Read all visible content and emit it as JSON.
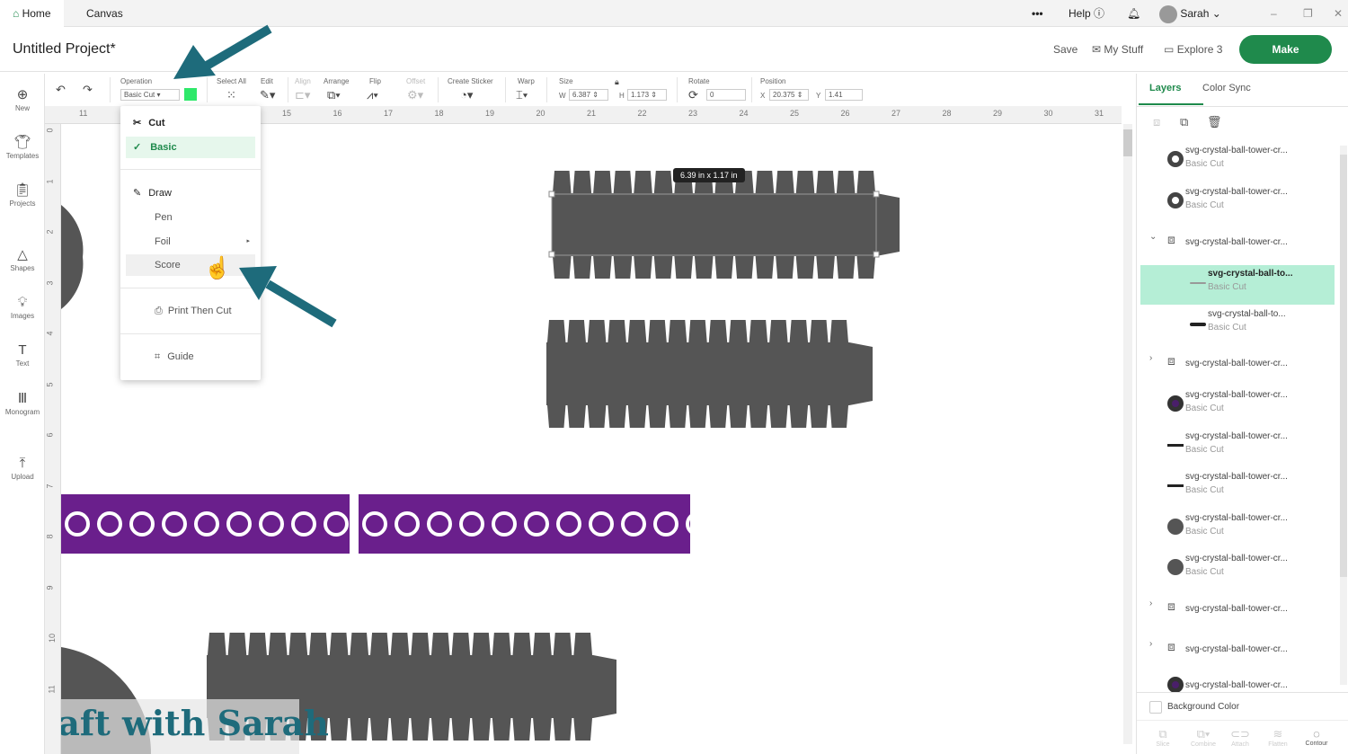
{
  "topbar": {
    "tabs": [
      {
        "label": "Home"
      },
      {
        "label": "Canvas"
      }
    ],
    "more": "•••",
    "help": "Help",
    "user": "Sarah"
  },
  "header": {
    "title": "Untitled Project*",
    "save": "Save",
    "my_stuff": "My Stuff",
    "machine": "Explore 3",
    "make": "Make"
  },
  "toolbar": {
    "operation_label": "Operation",
    "operation_value": "Basic Cut",
    "operation_color": "#2ee86a",
    "select_all": "Select All",
    "edit": "Edit",
    "align": "Align",
    "arrange": "Arrange",
    "flip": "Flip",
    "offset": "Offset",
    "create_sticker": "Create Sticker",
    "warp": "Warp",
    "size": "Size",
    "w_label": "W",
    "w": "6.387",
    "h_label": "H",
    "h": "1.173",
    "rotate": "Rotate",
    "rotate_value": "0",
    "position": "Position",
    "x_label": "X",
    "x": "20.375",
    "y_label": "Y",
    "y": "1.41"
  },
  "sidebar": [
    {
      "label": "New"
    },
    {
      "label": "Templates"
    },
    {
      "label": "Projects"
    },
    {
      "label": "Shapes"
    },
    {
      "label": "Images"
    },
    {
      "label": "Text"
    },
    {
      "label": "Monogram"
    },
    {
      "label": "Upload"
    }
  ],
  "ruler": {
    "h": [
      "11",
      "12",
      "13",
      "14",
      "15",
      "16",
      "17",
      "18",
      "19",
      "20",
      "21",
      "22",
      "23",
      "24",
      "25",
      "26",
      "27",
      "28",
      "29",
      "30",
      "31"
    ],
    "v": [
      "0",
      "1",
      "2",
      "3",
      "4",
      "5",
      "6",
      "7",
      "8",
      "9",
      "10",
      "11"
    ]
  },
  "operation_menu": {
    "cut": "Cut",
    "basic": "Basic",
    "draw": "Draw",
    "pen": "Pen",
    "foil": "Foil",
    "score": "Score",
    "print_then_cut": "Print Then Cut",
    "guide": "Guide"
  },
  "canvas": {
    "dimension_tooltip": "6.39  in x 1.17  in",
    "watermark": "Craft with Sarah"
  },
  "panel": {
    "tabs": [
      "Layers",
      "Color Sync"
    ],
    "layers": [
      {
        "name": "svg-crystal-ball-tower-cr...",
        "op": "Basic Cut"
      },
      {
        "name": "svg-crystal-ball-tower-cr...",
        "op": "Basic Cut"
      },
      {
        "name": "svg-crystal-ball-tower-cr...",
        "op": ""
      },
      {
        "name": "svg-crystal-ball-to...",
        "op": "Basic Cut"
      },
      {
        "name": "svg-crystal-ball-to...",
        "op": "Basic Cut"
      },
      {
        "name": "svg-crystal-ball-tower-cr...",
        "op": ""
      },
      {
        "name": "svg-crystal-ball-tower-cr...",
        "op": "Basic Cut"
      },
      {
        "name": "svg-crystal-ball-tower-cr...",
        "op": "Basic Cut"
      },
      {
        "name": "svg-crystal-ball-tower-cr...",
        "op": "Basic Cut"
      },
      {
        "name": "svg-crystal-ball-tower-cr...",
        "op": "Basic Cut"
      },
      {
        "name": "svg-crystal-ball-tower-cr...",
        "op": "Basic Cut"
      },
      {
        "name": "svg-crystal-ball-tower-cr...",
        "op": ""
      },
      {
        "name": "svg-crystal-ball-tower-cr...",
        "op": ""
      },
      {
        "name": "svg-crystal-ball-tower-cr...",
        "op": ""
      }
    ],
    "background_color": "Background Color",
    "bottom": [
      "Slice",
      "Combine",
      "Attach",
      "Flatten",
      "Contour"
    ]
  },
  "colors": {
    "accent": "#1f8a4c",
    "selected_layer": "#b5eed6",
    "purple": "#6a1f8c",
    "shape": "#555555",
    "arrow": "#1e6b7b"
  }
}
